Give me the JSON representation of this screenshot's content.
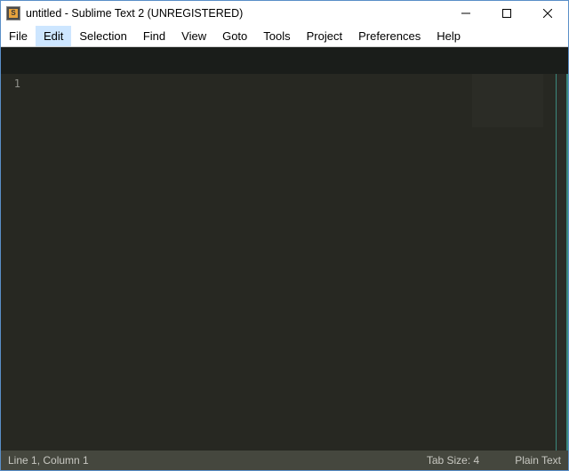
{
  "titlebar": {
    "app_icon_letter": "S",
    "title": "untitled - Sublime Text 2 (UNREGISTERED)"
  },
  "menubar": {
    "items": [
      "File",
      "Edit",
      "Selection",
      "Find",
      "View",
      "Goto",
      "Tools",
      "Project",
      "Preferences",
      "Help"
    ],
    "active_index": 1
  },
  "gutter": {
    "lines": [
      "1"
    ]
  },
  "statusbar": {
    "position": "Line 1, Column 1",
    "tab_size": "Tab Size: 4",
    "syntax": "Plain Text"
  }
}
